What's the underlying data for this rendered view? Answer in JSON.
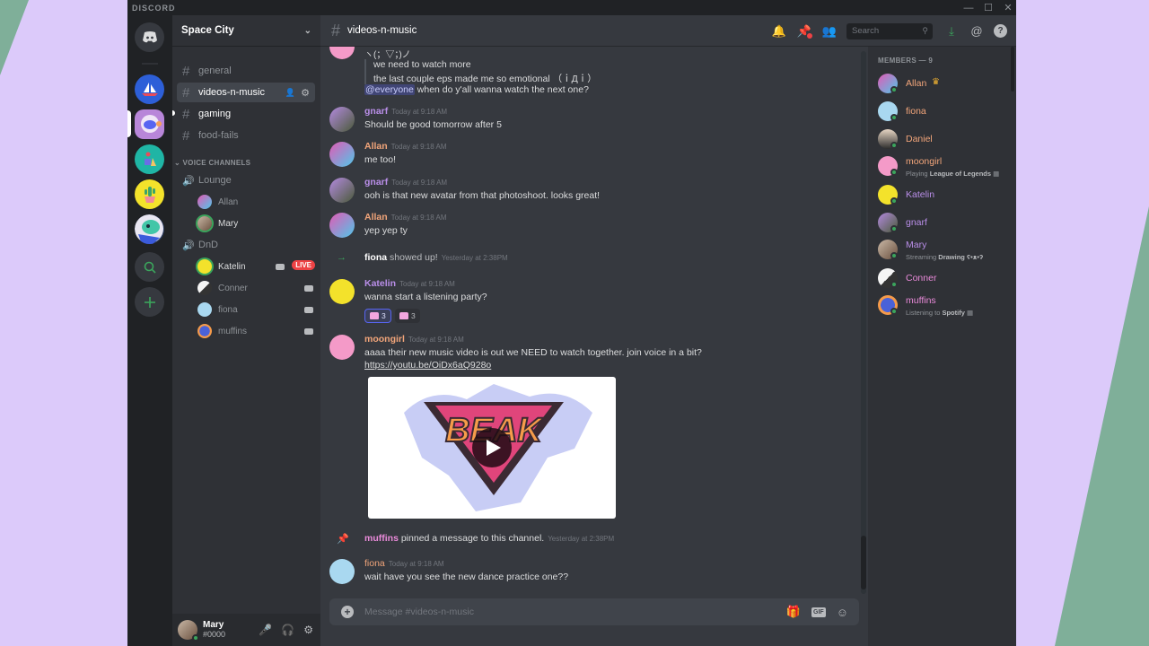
{
  "app": {
    "brand": "DISCORD",
    "window_controls": {
      "minimize": "—",
      "maximize": "☐",
      "close": "✕"
    }
  },
  "colors": {
    "accent": "#5865f2",
    "online": "#3ba55c",
    "live": "#ed4245",
    "link": "#00aff4",
    "background": "#dccafa",
    "wedge": "#7faf99"
  },
  "servers": [
    {
      "name": "Discord Home",
      "icon": "discord-logo-icon"
    },
    {
      "name": "Sailboat server",
      "icon": "sailboat-icon"
    },
    {
      "name": "Space City",
      "icon": "astronaut-icon",
      "active": true
    },
    {
      "name": "Teal server",
      "icon": "art-icon"
    },
    {
      "name": "Cactus server",
      "icon": "cactus-icon"
    },
    {
      "name": "Creature server",
      "icon": "creature-icon"
    },
    {
      "name": "Explore",
      "icon": "search-icon"
    },
    {
      "name": "Add a Server",
      "icon": "plus-icon"
    }
  ],
  "guild": {
    "name": "Space City"
  },
  "text_channels": [
    {
      "name": "general",
      "state": "muted"
    },
    {
      "name": "videos-n-music",
      "state": "active"
    },
    {
      "name": "gaming",
      "state": "unread"
    },
    {
      "name": "food-fails",
      "state": "muted"
    }
  ],
  "voice_category": "VOICE CHANNELS",
  "voice_channels": [
    {
      "name": "Lounge",
      "users": [
        {
          "name": "Allan"
        },
        {
          "name": "Mary",
          "speaking": true
        }
      ]
    },
    {
      "name": "DnD",
      "users": [
        {
          "name": "Katelin",
          "speaking": true,
          "video": true,
          "live": "LIVE"
        },
        {
          "name": "Conner",
          "video": true
        },
        {
          "name": "fiona",
          "video": true
        },
        {
          "name": "muffins",
          "video": true
        }
      ]
    }
  ],
  "user_panel": {
    "name": "Mary",
    "tag": "#0000"
  },
  "channel_header": {
    "name": "videos-n-music",
    "search_placeholder": "Search"
  },
  "messages": {
    "partial": {
      "line0": "ヽ(；▽；)ノ",
      "quote1": "we need to watch more",
      "quote2": "the last couple eps made me so emotional （ｉДｉ）",
      "mention": "@everyone",
      "rest": " when do y'all wanna watch the next one?"
    },
    "list": [
      {
        "author": "gnarf",
        "color": "#b98ee8",
        "time": "Today at 9:18 AM",
        "text": "Should be good tomorrow after 5"
      },
      {
        "author": "Allan",
        "color": "#f2a57a",
        "time": "Today at 9:18 AM",
        "text": "me too!"
      },
      {
        "author": "gnarf",
        "color": "#b98ee8",
        "time": "Today at 9:18 AM",
        "text": "ooh is that new avatar from that photoshoot. looks great!"
      },
      {
        "author": "Allan",
        "color": "#f2a57a",
        "time": "Today at 9:18 AM",
        "text": "yep yep ty"
      }
    ],
    "join": {
      "user": "fiona",
      "text": " showed up!",
      "time": "Yesterday at 2:38PM"
    },
    "katelin": {
      "author": "Katelin",
      "color": "#b98ee8",
      "time": "Today at 9:18 AM",
      "text": "wanna start a listening party?",
      "reactions": [
        {
          "count": "3",
          "me": true
        },
        {
          "count": "3",
          "me": false
        }
      ]
    },
    "moongirl": {
      "author": "moongirl",
      "color": "#f2a57a",
      "time": "Today at 9:18 AM",
      "text": "aaaa their new music video is out we NEED to watch together. join voice in a bit?",
      "link": "https://youtu.be/OiDx6aQ928o",
      "embed_title": "BEAK"
    },
    "pin": {
      "user": "muffins",
      "text": " pinned a message to this channel.",
      "time": "Yesterday at 2:38PM"
    },
    "fiona": {
      "author": "fiona",
      "color": "#f2a57a",
      "time": "Today at 9:18 AM",
      "text": "wait have you see the new dance practice one??"
    }
  },
  "composer": {
    "placeholder": "Message #videos-n-music"
  },
  "members": {
    "header": "MEMBERS — 9",
    "list": [
      {
        "name": "Allan",
        "color": "#f2a57a",
        "crown": true
      },
      {
        "name": "fiona",
        "color": "#f2a57a"
      },
      {
        "name": "Daniel",
        "color": "#f2a57a"
      },
      {
        "name": "moongirl",
        "color": "#f2a57a",
        "activity_prefix": "Playing ",
        "activity": "League of Legends"
      },
      {
        "name": "Katelin",
        "color": "#b98ee8"
      },
      {
        "name": "gnarf",
        "color": "#b98ee8"
      },
      {
        "name": "Mary",
        "color": "#b98ee8",
        "activity_prefix": "Streaming ",
        "activity": "Drawing ʕ•ᴥ•ʔ"
      },
      {
        "name": "Conner",
        "color": "#e98ad9"
      },
      {
        "name": "muffins",
        "color": "#e98ad9",
        "activity_prefix": "Listening to ",
        "activity": "Spotify"
      }
    ]
  }
}
